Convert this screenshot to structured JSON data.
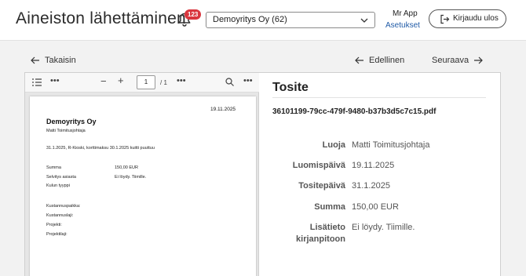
{
  "header": {
    "title": "Aineiston lähettäminen",
    "notification_count": "123",
    "company_select": "Demoyritys Oy (62)",
    "user_name": "Mr App",
    "settings_link": "Asetukset",
    "logout_label": "Kirjaudu ulos"
  },
  "nav": {
    "back": "Takaisin",
    "previous": "Edellinen",
    "next": "Seuraava"
  },
  "viewer": {
    "page_current": "1",
    "page_total": "/ 1",
    "document": {
      "date": "19.11.2025",
      "company": "Demoyritys Oy",
      "person": "Matti Toimitusjohtaja",
      "description": "31.1.2025, R-Kioski, korttimaksu 30.1.2025 kuitti puuttuu",
      "rows": [
        {
          "label": "Summa",
          "value": "150,00 EUR"
        },
        {
          "label": "Selvitys asiasta",
          "value": "Ei löydy. Tiimille."
        },
        {
          "label": "Kulun tyyppi",
          "value": ""
        },
        {
          "label": "Kustannuspaikka:",
          "value": ""
        },
        {
          "label": "Kustannuslaji:",
          "value": ""
        },
        {
          "label": "Projekti:",
          "value": ""
        },
        {
          "label": "Projektilaji:",
          "value": ""
        }
      ]
    }
  },
  "details": {
    "title": "Tosite",
    "filename": "36101199-79cc-479f-9480-b37b3d5c7c15.pdf",
    "fields": [
      {
        "label": "Luoja",
        "value": "Matti Toimitusjohtaja"
      },
      {
        "label": "Luomispäivä",
        "value": "19.11.2025"
      },
      {
        "label": "Tositepäivä",
        "value": "31.1.2025"
      },
      {
        "label": "Summa",
        "value": "150,00 EUR"
      },
      {
        "label_line1": "Lisätieto",
        "label_line2": "kirjanpitoon",
        "value": "Ei löydy. Tiimille."
      }
    ]
  },
  "colors": {
    "badge": "#d9363e",
    "link": "#1f5aa6"
  }
}
